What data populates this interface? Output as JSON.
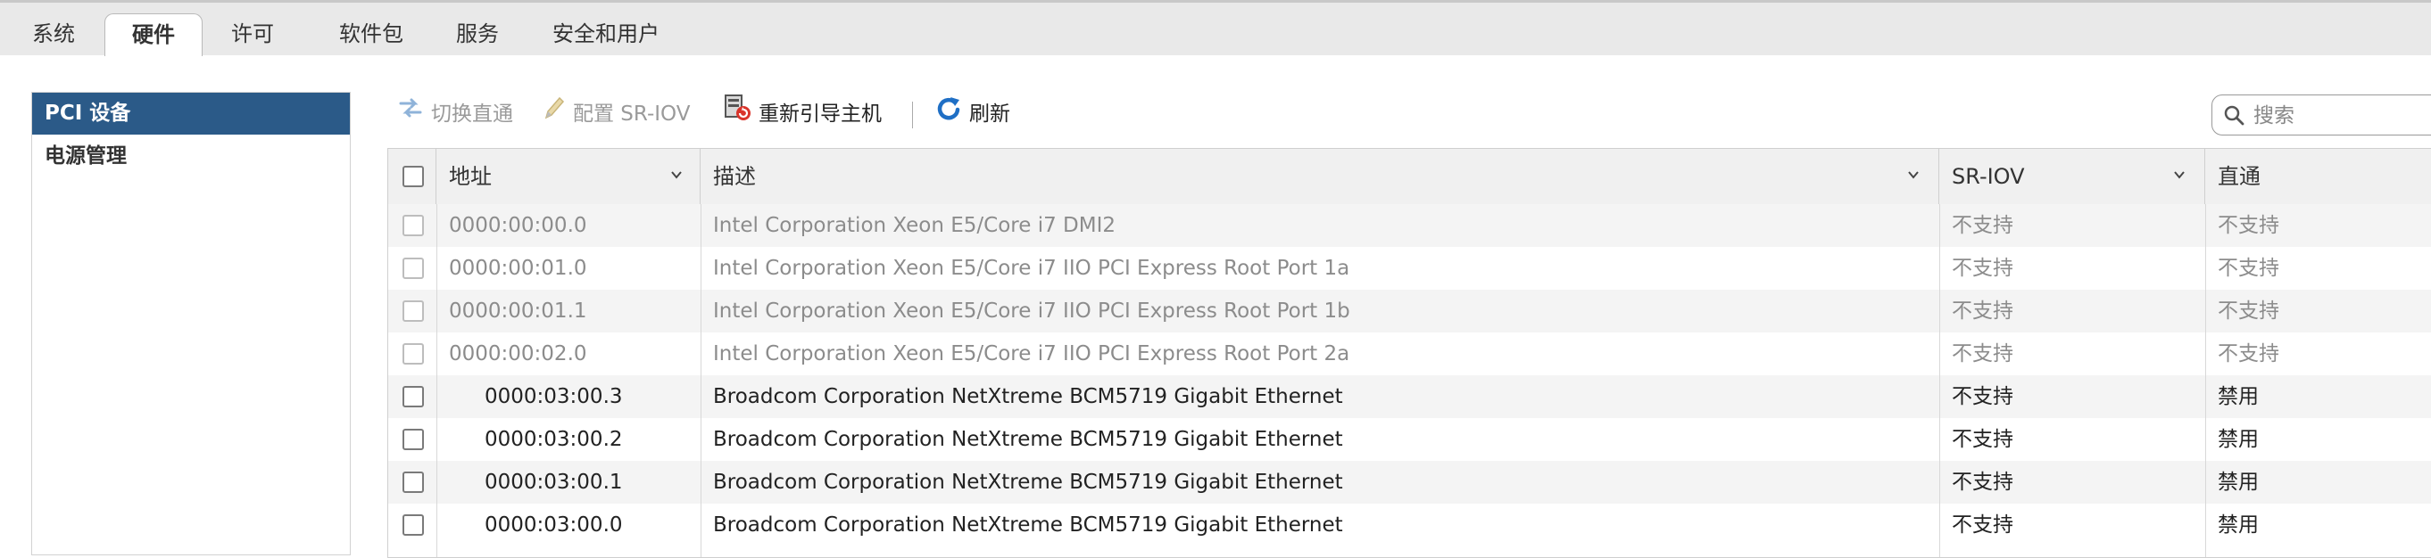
{
  "tabs": [
    {
      "label": "系统"
    },
    {
      "label": "硬件"
    },
    {
      "label": "许可"
    },
    {
      "label": "软件包"
    },
    {
      "label": "服务"
    },
    {
      "label": "安全和用户"
    }
  ],
  "active_tab": "硬件",
  "sidebar": {
    "items": [
      {
        "label": "PCI 设备",
        "active": true
      },
      {
        "label": "电源管理",
        "active": false
      }
    ]
  },
  "toolbar": {
    "toggle_passthrough": "切换直通",
    "configure_sriov": "配置 SR-IOV",
    "reboot_host": "重新引导主机",
    "refresh": "刷新"
  },
  "search": {
    "placeholder": "搜索"
  },
  "table": {
    "columns": {
      "address": "地址",
      "description": "描述",
      "sriov": "SR-IOV",
      "passthrough": "直通"
    },
    "rows": [
      {
        "address": "0000:00:00.0",
        "description": "Intel Corporation Xeon E5/Core i7 DMI2",
        "sriov": "不支持",
        "passthrough": "不支持",
        "indent": false,
        "dim": true
      },
      {
        "address": "0000:00:01.0",
        "description": "Intel Corporation Xeon E5/Core i7 IIO PCI Express Root Port 1a",
        "sriov": "不支持",
        "passthrough": "不支持",
        "indent": false,
        "dim": true
      },
      {
        "address": "0000:00:01.1",
        "description": "Intel Corporation Xeon E5/Core i7 IIO PCI Express Root Port 1b",
        "sriov": "不支持",
        "passthrough": "不支持",
        "indent": false,
        "dim": true
      },
      {
        "address": "0000:00:02.0",
        "description": "Intel Corporation Xeon E5/Core i7 IIO PCI Express Root Port 2a",
        "sriov": "不支持",
        "passthrough": "不支持",
        "indent": false,
        "dim": true
      },
      {
        "address": "0000:03:00.3",
        "description": "Broadcom Corporation NetXtreme BCM5719 Gigabit Ethernet",
        "sriov": "不支持",
        "passthrough": "禁用",
        "indent": true,
        "dim": false
      },
      {
        "address": "0000:03:00.2",
        "description": "Broadcom Corporation NetXtreme BCM5719 Gigabit Ethernet",
        "sriov": "不支持",
        "passthrough": "禁用",
        "indent": true,
        "dim": false
      },
      {
        "address": "0000:03:00.1",
        "description": "Broadcom Corporation NetXtreme BCM5719 Gigabit Ethernet",
        "sriov": "不支持",
        "passthrough": "禁用",
        "indent": true,
        "dim": false
      },
      {
        "address": "0000:03:00.0",
        "description": "Broadcom Corporation NetXtreme BCM5719 Gigabit Ethernet",
        "sriov": "不支持",
        "passthrough": "禁用",
        "indent": true,
        "dim": false
      }
    ]
  },
  "icons": {
    "toggle_passthrough": "swap-icon",
    "configure_sriov": "pencil-icon",
    "reboot_host": "host-reboot-icon",
    "refresh": "refresh-icon",
    "search": "search-icon",
    "sort": "chevron-down-icon"
  },
  "colors": {
    "sidebar_active_bg": "#2b5a88",
    "refresh_icon": "#1f6fc5",
    "tabbar_bg": "#e9e9e9"
  }
}
